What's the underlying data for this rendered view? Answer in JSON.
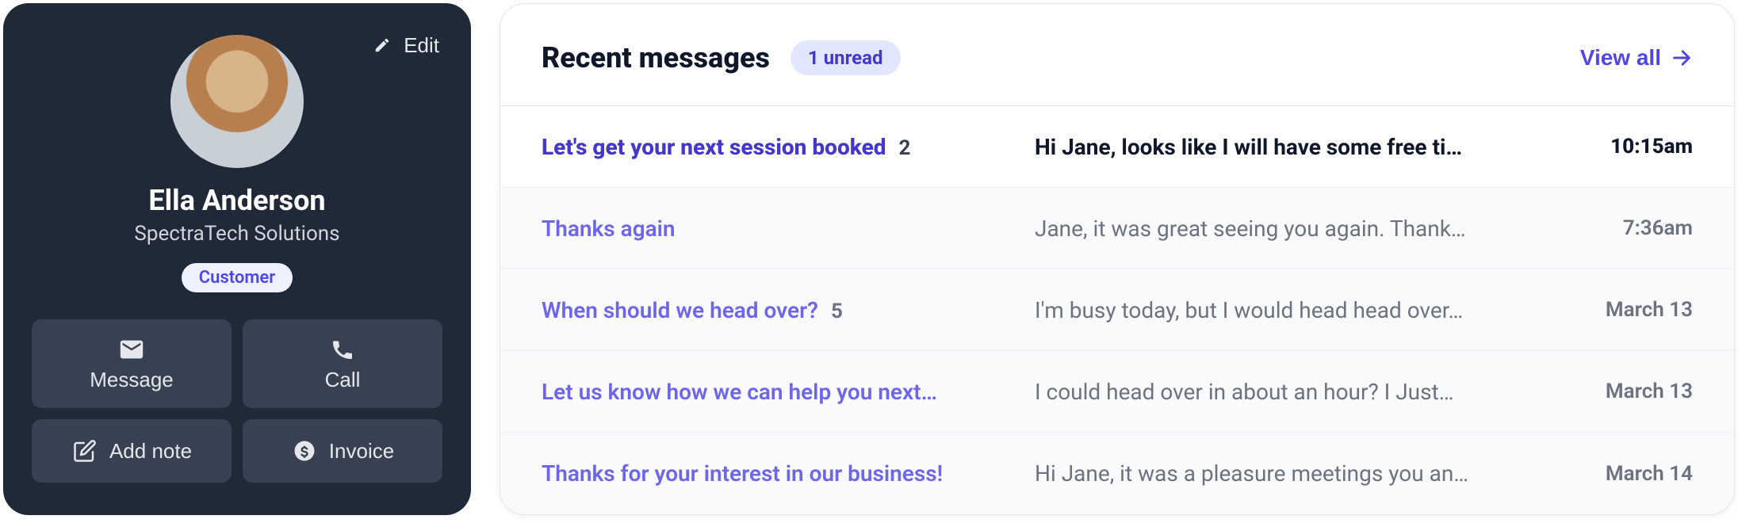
{
  "profile": {
    "edit_label": "Edit",
    "name": "Ella Anderson",
    "company": "SpectraTech Solutions",
    "role": "Customer",
    "actions": {
      "message": "Message",
      "call": "Call",
      "add_note": "Add note",
      "invoice": "Invoice"
    }
  },
  "messages": {
    "title": "Recent messages",
    "unread_badge": "1 unread",
    "view_all": "View all",
    "items": [
      {
        "subject": "Let's get your next session booked",
        "count": "2",
        "preview": "Hi Jane, looks like I will have some free ti…",
        "time": "10:15am",
        "unread": true
      },
      {
        "subject": "Thanks again",
        "count": "",
        "preview": "Jane, it was great seeing you again. Thank…",
        "time": "7:36am",
        "unread": false
      },
      {
        "subject": "When should we head over?",
        "count": "5",
        "preview": "I'm busy today, but I would head head over…",
        "time": "March 13",
        "unread": false
      },
      {
        "subject": "Let us know how we can help you next…",
        "count": "",
        "preview": "I could head over in about an hour? I Just…",
        "time": "March 13",
        "unread": false
      },
      {
        "subject": "Thanks for your interest in our business!",
        "count": "",
        "preview": "Hi Jane, it was a pleasure meetings you an…",
        "time": "March 14",
        "unread": false
      }
    ]
  }
}
